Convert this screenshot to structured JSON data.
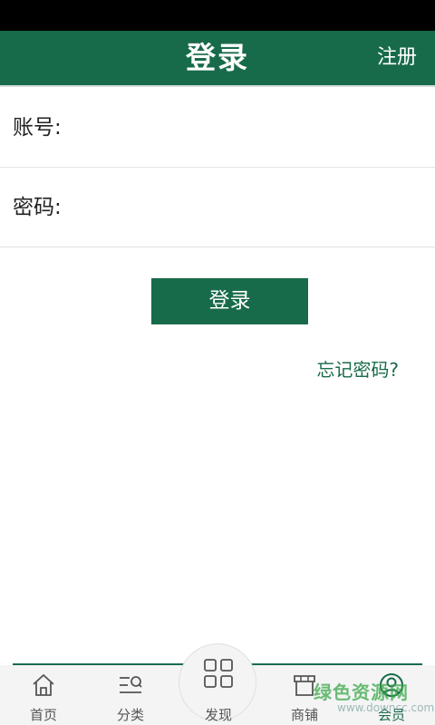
{
  "header": {
    "title": "登录",
    "register_label": "注册"
  },
  "form": {
    "account_label": "账号:",
    "account_value": "",
    "password_label": "密码:",
    "password_value": ""
  },
  "login_button_label": "登录",
  "forgot_label": "忘记密码?",
  "tabbar": {
    "items": [
      {
        "label": "首页",
        "icon": "home-icon"
      },
      {
        "label": "分类",
        "icon": "category-icon"
      },
      {
        "label": "发现",
        "icon": "discover-icon"
      },
      {
        "label": "商铺",
        "icon": "shop-icon"
      },
      {
        "label": "会员",
        "icon": "member-icon",
        "active": true
      }
    ]
  },
  "watermark": {
    "text": "绿色资源网",
    "url": "www.downcc.com"
  },
  "colors": {
    "primary": "#186b4a",
    "status_bar": "#000000",
    "tabbar_bg": "#f4f4f4"
  }
}
